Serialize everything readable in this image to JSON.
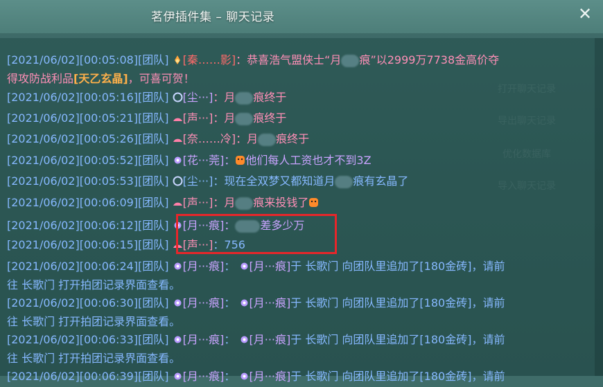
{
  "window": {
    "title": "茗伊插件集 – 聊天记录",
    "close_symbol": "✕"
  },
  "side_buttons": [
    "打开聊天记录",
    "导出聊天记录",
    "优化数据库",
    "导入聊天记录"
  ],
  "messages": [
    {
      "ts": "[2021/06/02][00:05:08]",
      "ch": "[团队]",
      "sender": "[秦……影]",
      "rest": "：恭喜浩气盟侠士“月",
      "rest2": "痕”以2999万7738金高价夺",
      "wrap": "得攻防战利品",
      "item": "[天乙玄晶]",
      "tail": "，可喜可贺！"
    },
    {
      "ts": "[2021/06/02][00:05:16]",
      "ch": "[团队]",
      "sender": "[尘···]",
      "text_a": "：月",
      "text_b": "痕终于"
    },
    {
      "ts": "[2021/06/02][00:05:21]",
      "ch": "[团队]",
      "sender": "[声···]",
      "text_a": "：月",
      "text_b": "痕终于"
    },
    {
      "ts": "[2021/06/02][00:05:26]",
      "ch": "[团队]",
      "sender": "[奈……冷]",
      "text_a": "：月",
      "text_b": "痕终于"
    },
    {
      "ts": "[2021/06/02][00:05:52]",
      "ch": "[团队]",
      "sender": "[花···莞]",
      "text_a": "：",
      "text_b": "他们每人工资也才不到3Z"
    },
    {
      "ts": "[2021/06/02][00:05:53]",
      "ch": "[团队]",
      "sender": "[尘···]",
      "text_a": "：现在全双梦又都知道月",
      "text_b": "痕有玄晶了"
    },
    {
      "ts": "[2021/06/02][00:06:09]",
      "ch": "[团队]",
      "sender": "[声···]",
      "text_a": "：月",
      "text_b": "痕来投钱了"
    },
    {
      "ts": "[2021/06/02][00:06:12]",
      "ch": "[团队]",
      "sender": "[月···痕]",
      "text_a": "：",
      "text_b": "差多少万"
    },
    {
      "ts": "[2021/06/02][00:06:15]",
      "ch": "[团队]",
      "sender": "[声···]",
      "text_a": "：756",
      "text_b": ""
    },
    {
      "ts": "[2021/06/02][00:06:24]",
      "ch": "[团队]",
      "sender": "[月···痕]",
      "text_a": "：",
      "sender2": "[月···痕]",
      "text_b": "于 长歌门 向团队里追加了[180金砖]，请前",
      "wrap": "往 长歌门 打开拍团记录界面查看。"
    },
    {
      "ts": "[2021/06/02][00:06:30]",
      "ch": "[团队]",
      "sender": "[月···痕]",
      "text_a": "：",
      "sender2": "[月···痕]",
      "text_b": "于 长歌门 向团队里追加了[180金砖]，请前",
      "wrap": "往 长歌门 打开拍团记录界面查看。"
    },
    {
      "ts": "[2021/06/02][00:06:33]",
      "ch": "[团队]",
      "sender": "[月···痕]",
      "text_a": "：",
      "sender2": "[月···痕]",
      "text_b": "于 长歌门 向团队里追加了[180金砖]，请前",
      "wrap": "往 长歌门 打开拍团记录界面查看。"
    },
    {
      "ts": "[2021/06/02][00:06:39]",
      "ch": "[团队]",
      "sender": "[月···痕]",
      "text_a": "：",
      "sender2": "[月···痕]",
      "text_b": "于 长歌门 向团队里追加了[180金砖]，请前",
      "wrap": ""
    }
  ]
}
